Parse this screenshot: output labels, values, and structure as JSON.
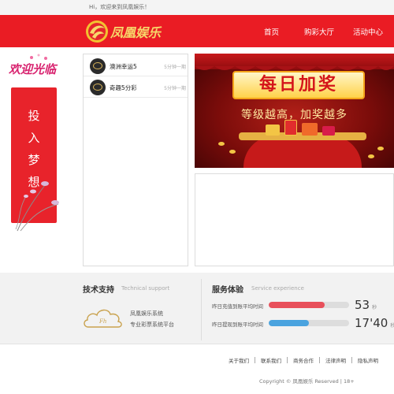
{
  "topbar": {
    "greeting": "Hi，欢迎来到凤凰娱乐！"
  },
  "header": {
    "brand": "凤凰娱乐",
    "nav": [
      {
        "label": "首页"
      },
      {
        "label": "购彩大厅"
      },
      {
        "label": "活动中心"
      }
    ]
  },
  "sidebar": {
    "welcome": "欢迎光临",
    "vertical_chars": [
      "投",
      "入",
      "梦",
      "想"
    ]
  },
  "lottery_list": [
    {
      "name": "澳洲幸运5",
      "frequency": "5分钟一期"
    },
    {
      "name": "奇趣5分彩",
      "frequency": "5分钟一期"
    }
  ],
  "banner": {
    "title": "每日加奖",
    "subtitle": "等级越高，加奖越多"
  },
  "support": {
    "title": "技术支持",
    "subtitle": "Technical support",
    "lines": [
      "凤凰娱乐系统",
      "专业彩票系统平台"
    ]
  },
  "service": {
    "title": "服务体验",
    "subtitle": "Service experience",
    "stats": [
      {
        "label": "昨日充值到账平均时间",
        "value": "53",
        "unit": "秒",
        "fill": 0.7,
        "color": "#e8505b"
      },
      {
        "label": "昨日提现到账平均时间",
        "value": "17'40",
        "unit": "秒",
        "fill": 0.5,
        "color": "#4aa3df"
      }
    ]
  },
  "footer": {
    "links": [
      "关于我们",
      "联系我们",
      "商务合作",
      "法律声明",
      "隐私声明"
    ],
    "copyright": "Copyright © 凤凰娱乐 Reserved | 18+"
  },
  "colors": {
    "brand_red": "#ea1c24",
    "gold": "#f7d86a"
  }
}
